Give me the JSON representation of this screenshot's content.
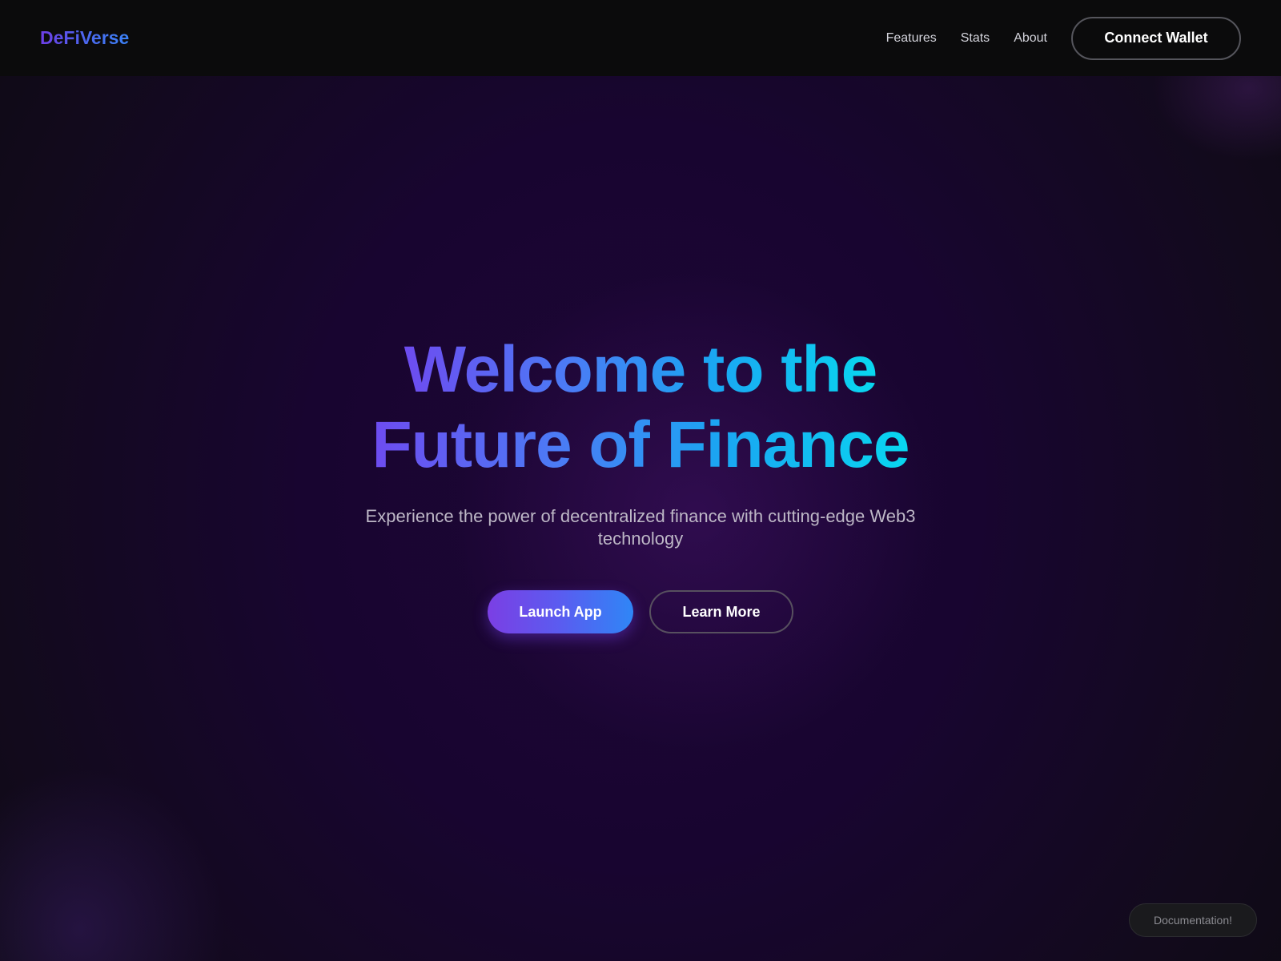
{
  "header": {
    "logo": "DeFiVerse",
    "nav": {
      "features": "Features",
      "stats": "Stats",
      "about": "About"
    },
    "connect_wallet": "Connect Wallet"
  },
  "hero": {
    "title_line1": "Welcome to the",
    "title_line2": "Future of Finance",
    "subtitle": "Experience the power of decentralized finance with cutting-edge Web3 technology",
    "launch_label": "Launch App",
    "learn_label": "Learn More"
  },
  "footer": {
    "documentation": "Documentation!"
  },
  "colors": {
    "brand_purple": "#7b3fe4",
    "brand_blue": "#2f86f6",
    "brand_cyan": "#08d8f0",
    "background": "#0b0a10"
  }
}
